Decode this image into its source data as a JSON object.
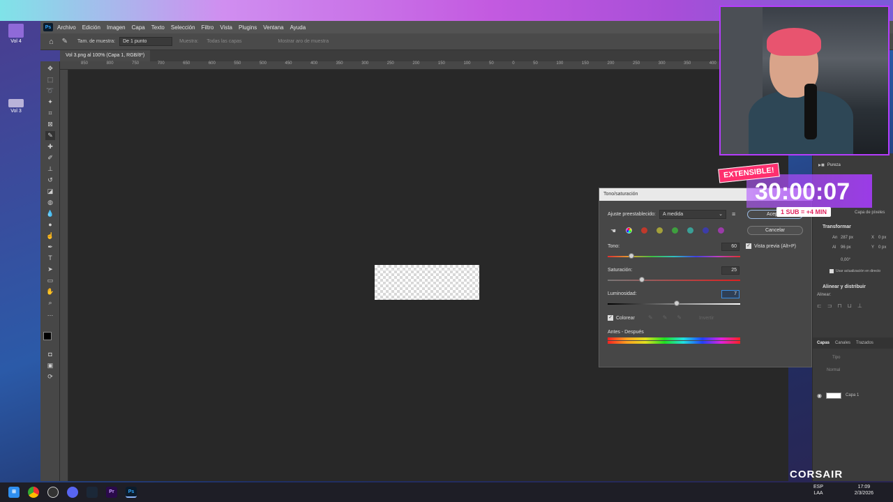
{
  "desktop": {
    "icons": [
      {
        "label": "Vol 4"
      },
      {
        "label": "Vol 3"
      }
    ]
  },
  "photoshop": {
    "logo": "Ps",
    "menu": [
      "Archivo",
      "Edición",
      "Imagen",
      "Capa",
      "Texto",
      "Selección",
      "Filtro",
      "Vista",
      "Plugins",
      "Ventana",
      "Ayuda"
    ],
    "options": {
      "sample_size_label": "Tam. de muestra:",
      "sample_size_value": "De 1 punto",
      "sample_label": "Muestra:",
      "sample_value": "Todas las capas",
      "show_ring": "Mostrar aro de muestra"
    },
    "document_tab": "Vol 3.png al 100% (Capa 1, RGB/8*)",
    "ruler_ticks": [
      "850",
      "800",
      "750",
      "700",
      "650",
      "600",
      "550",
      "500",
      "450",
      "400",
      "350",
      "300",
      "250",
      "200",
      "150",
      "100",
      "50",
      "0",
      "50",
      "100",
      "150",
      "200",
      "250",
      "300",
      "350",
      "400",
      "450",
      "500"
    ]
  },
  "dialog": {
    "title": "Tono/saturación",
    "preset_label": "Ajuste preestablecido:",
    "preset_value": "A medida",
    "ok_label": "Aceptar",
    "cancel_label": "Cancelar",
    "hue_label": "Tono:",
    "hue_value": "60",
    "saturation_label": "Saturación:",
    "saturation_value": "25",
    "lightness_label": "Luminosidad:",
    "lightness_value": "7",
    "preview_label": "Vista previa (Alt+P)",
    "colorize_label": "Colorear",
    "invert_label": "Invertir",
    "before_after_label": "Antes - Después",
    "levels": {
      "hue": 0.18,
      "saturation": 0.26,
      "lightness": 0.52
    },
    "swatch_colors": [
      "#c0392b",
      "#a3a03a",
      "#3e9f3e",
      "#3a9f96",
      "#3c3ca8",
      "#9a3aa8"
    ]
  },
  "right_panel": {
    "folder": "Pureza",
    "transform_title": "Transformar",
    "width_label": "An",
    "width_value": "287 px",
    "height_label": "Al",
    "height_value": "96 px",
    "x_label": "X",
    "x_value": "0 px",
    "y_label": "Y",
    "y_value": "0 px",
    "angle_value": "0,00°",
    "live_update": "Usar actualización en directo",
    "align_title": "Alinear y distribuir",
    "align_label": "Alinear:",
    "tabs": [
      "Capas",
      "Canales",
      "Trazados"
    ],
    "search_placeholder": "Tipo",
    "blend_mode": "Normal",
    "layer_name": "Capa 1",
    "pixel_layer_label": "Capa de píxeles"
  },
  "stream_overlay": {
    "extensible": "EXTENSIBLE!",
    "timer": "30:00:07",
    "sub_rule": "1 SUB = +4 MIN",
    "brand": "CORSAIR"
  },
  "taskbar": {
    "apps": [
      "start-icon",
      "chrome-icon",
      "obs-icon",
      "discord-icon",
      "steam-icon",
      "premiere-icon",
      "photoshop-icon"
    ],
    "app_labels": [
      "",
      "",
      "",
      "",
      "",
      "Pr",
      "Ps"
    ],
    "lang_top": "ESP",
    "lang_bottom": "LAA",
    "time": "17:09",
    "date": "2/3/2026"
  }
}
